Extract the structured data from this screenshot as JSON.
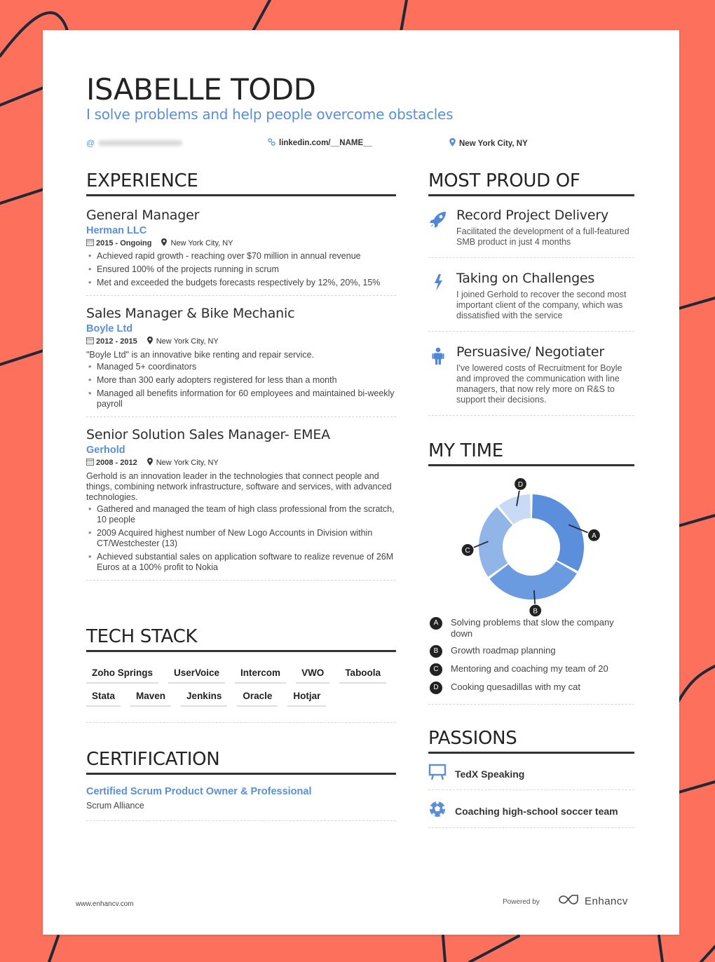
{
  "header": {
    "name": "ISABELLE TODD",
    "tagline": "I solve problems and help people overcome obstacles",
    "email_icon": "@",
    "linkedin": "linkedin.com/__NAME__",
    "location": "New York City, NY"
  },
  "experience": {
    "title": "EXPERIENCE",
    "jobs": [
      {
        "title": "General Manager",
        "company": "Herman LLC",
        "dates": "2015 - Ongoing",
        "location": "New York City, NY",
        "description": "",
        "bullets": [
          "Achieved rapid growth - reaching over $70 million in annual revenue",
          "Ensured 100% of the projects running in scrum",
          "Met and exceeded the budgets forecasts respectively by 12%, 20%, 15%"
        ]
      },
      {
        "title": "Sales Manager & Bike Mechanic",
        "company": "Boyle Ltd",
        "dates": "2012 - 2015",
        "location": "New York City, NY",
        "description": "\"Boyle Ltd\" is an innovative bike renting and repair service.",
        "bullets": [
          "Managed 5+ coordinators",
          "More than 300 early adopters registered for less than a month",
          "Managed all benefits information for 60 employees and maintained bi-weekly payroll"
        ]
      },
      {
        "title": "Senior Solution Sales Manager- EMEA",
        "company": "Gerhold",
        "dates": "2008 - 2012",
        "location": "New York City, NY",
        "description": "Gerhold is an innovation leader in the technologies that connect people and things, combining network infrastructure, software and services, with advanced technologies.",
        "bullets": [
          "Gathered and managed the team of high class professional from the scratch, 10 people",
          "2009 Acquired highest number of New Logo Accounts in Division within CT/Westchester (13)",
          "Achieved substantial sales on application software to realize revenue of 26M Euros at a 100% profit to Nokia"
        ]
      }
    ]
  },
  "tech_stack": {
    "title": "TECH STACK",
    "items": [
      "Zoho Springs",
      "UserVoice",
      "Intercom",
      "VWO",
      "Taboola",
      "Stata",
      "Maven",
      "Jenkins",
      "Oracle",
      "Hotjar"
    ]
  },
  "certification": {
    "title": "CERTIFICATION",
    "name": "Certified Scrum Product Owner & Professional",
    "issuer": "Scrum Alliance"
  },
  "most_proud_of": {
    "title": "MOST PROUD OF",
    "items": [
      {
        "icon": "rocket-icon",
        "title": "Record Project Delivery",
        "description": "Facilitated the development of a full-featured SMB product in just 4 months"
      },
      {
        "icon": "lightning-icon",
        "title": "Taking on Challenges",
        "description": "I joined Gerhold to recover the second most important client of the company, which was dissatisfied with the service"
      },
      {
        "icon": "person-icon",
        "title": "Persuasive/ Negotiater",
        "description": "I've lowered costs of Recruitment for Boyle and improved the communication with line managers, that now rely more on R&S to support their decisions."
      }
    ]
  },
  "my_time": {
    "title": "MY TIME",
    "legend": [
      {
        "key": "A",
        "label": "Solving problems that slow the company down"
      },
      {
        "key": "B",
        "label": "Growth roadmap planning"
      },
      {
        "key": "C",
        "label": "Mentoring and coaching my team of 20"
      },
      {
        "key": "D",
        "label": "Cooking quesadillas with my cat"
      }
    ]
  },
  "chart_data": {
    "type": "pie",
    "variant": "donut",
    "title": "MY TIME",
    "categories": [
      "A",
      "B",
      "C",
      "D"
    ],
    "labels": [
      "Solving problems that slow the company down",
      "Growth roadmap planning",
      "Mentoring and coaching my team of 20",
      "Cooking quesadillas with my cat"
    ],
    "values": [
      33,
      32,
      24,
      11
    ],
    "colors": [
      "#5b8fdc",
      "#6a9ae0",
      "#92b5e8",
      "#c9daf4"
    ]
  },
  "passions": {
    "title": "PASSIONS",
    "items": [
      {
        "icon": "presentation-board-icon",
        "label": "TedX Speaking"
      },
      {
        "icon": "soccer-ball-icon",
        "label": "Coaching high-school soccer team"
      }
    ]
  },
  "footer": {
    "url": "www.enhancv.com",
    "powered_by": "Powered by",
    "brand": "Enhancv"
  },
  "colors": {
    "background": "#fd705b",
    "accent": "#5a8fd6",
    "text": "#2b2b2b"
  }
}
